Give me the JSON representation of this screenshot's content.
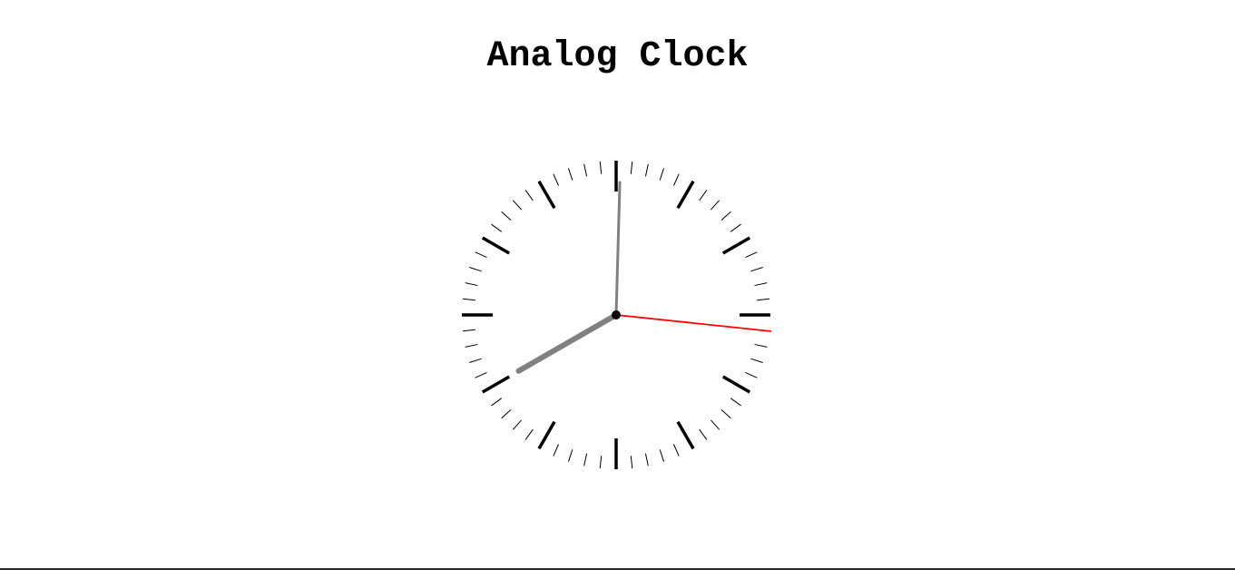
{
  "page": {
    "title": "Analog Clock"
  },
  "clock": {
    "time_shown": {
      "hours": 8,
      "minutes": 0,
      "seconds": 16
    },
    "colors": {
      "hour_hand": "#808080",
      "minute_hand": "#808080",
      "second_hand": "#ff0000",
      "major_ticks": "#000000",
      "minor_ticks": "#000000",
      "center_dot": "#000000",
      "background": "#ffffff"
    },
    "tick_marks": {
      "major_count": 12,
      "minor_count": 60
    }
  }
}
